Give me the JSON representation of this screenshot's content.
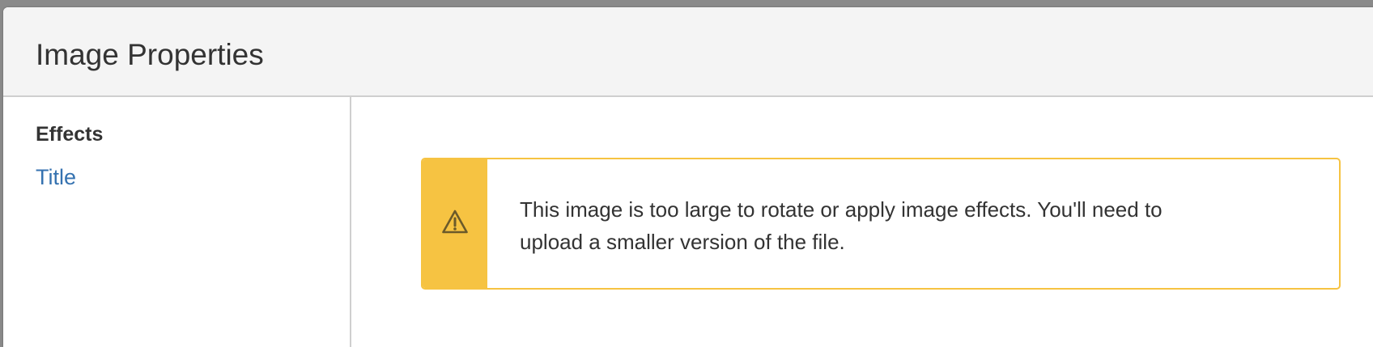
{
  "dialog": {
    "title": "Image Properties"
  },
  "sidebar": {
    "heading": "Effects",
    "items": [
      {
        "label": "Title"
      }
    ]
  },
  "warning": {
    "icon": "warning-icon",
    "message": "This image is too large to rotate or apply image effects. You'll need to upload a smaller version of the file."
  },
  "colors": {
    "warning_accent": "#f6c342",
    "link": "#3572b0",
    "header_bg": "#f4f4f4",
    "text": "#333333"
  }
}
